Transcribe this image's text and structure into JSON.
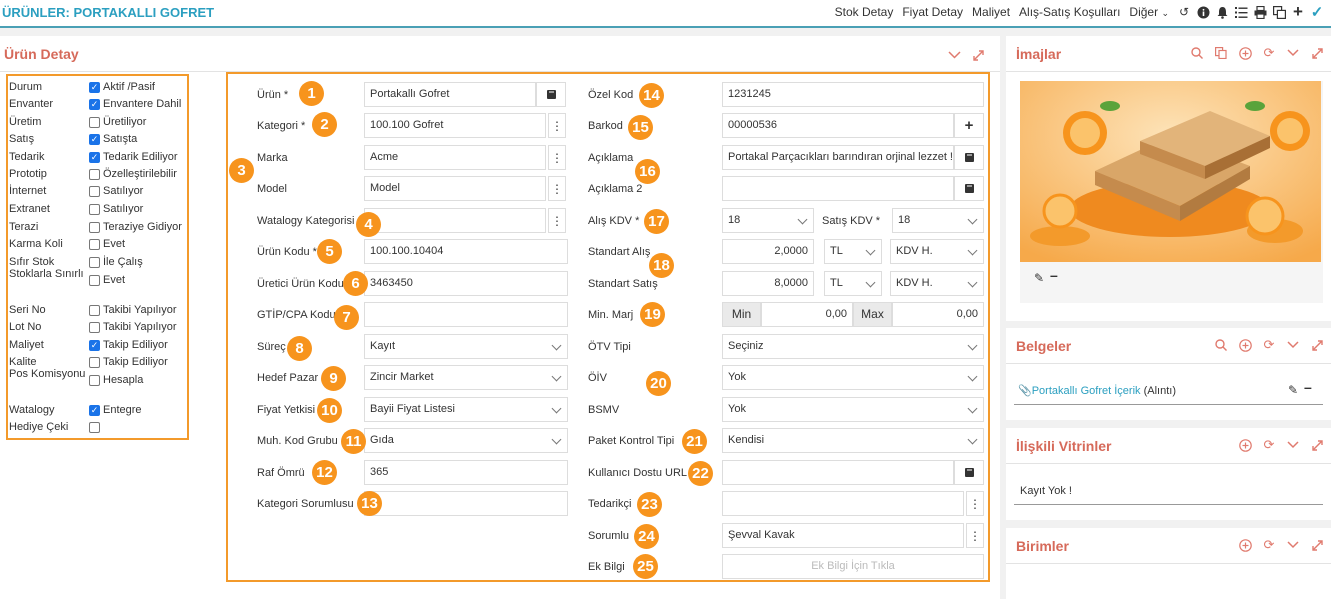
{
  "header": {
    "title": "ÜRÜNLER: PORTAKALLI GOFRET",
    "nav": [
      "Stok Detay",
      "Fiyat Detay",
      "Maliyet",
      "Alış-Satış Koşulları",
      "Diğer"
    ],
    "icons": [
      "history-icon",
      "info-icon",
      "bell-icon",
      "list-icon",
      "print-icon",
      "copy-icon",
      "plus-icon"
    ]
  },
  "main": {
    "title": "Ürün Detay"
  },
  "status": [
    {
      "label": "Durum",
      "checked": true,
      "value": "Aktif /Pasif"
    },
    {
      "label": "Envanter",
      "checked": true,
      "value": "Envantere Dahil"
    },
    {
      "label": "Üretim",
      "checked": false,
      "value": "Üretiliyor"
    },
    {
      "label": "Satış",
      "checked": true,
      "value": "Satışta"
    },
    {
      "label": "Tedarik",
      "checked": true,
      "value": "Tedarik Ediliyor"
    },
    {
      "label": "Prototip",
      "checked": false,
      "value": "Özelleştirilebilir"
    },
    {
      "label": "İnternet",
      "checked": false,
      "value": "Satılıyor"
    },
    {
      "label": "Extranet",
      "checked": false,
      "value": "Satılıyor"
    },
    {
      "label": "Terazi",
      "checked": false,
      "value": "Teraziye Gidiyor"
    },
    {
      "label": "Karma Koli",
      "checked": false,
      "value": "Evet"
    },
    {
      "label": "Sıfır Stok",
      "checked": false,
      "value": "İle Çalış"
    },
    {
      "label": "Stoklarla Sınırlı",
      "checked": false,
      "value": "Evet"
    },
    {
      "label": "Seri No",
      "checked": false,
      "value": "Takibi Yapılıyor"
    },
    {
      "label": "Lot No",
      "checked": false,
      "value": "Takibi Yapılıyor"
    },
    {
      "label": "Maliyet",
      "checked": true,
      "value": "Takip Ediliyor"
    },
    {
      "label": "Kalite",
      "checked": false,
      "value": "Takip Ediliyor"
    },
    {
      "label": "Pos Komisyonu",
      "checked": false,
      "value": "Hesapla"
    },
    {
      "label": "Watalogy",
      "checked": true,
      "value": "Entegre"
    },
    {
      "label": "Hediye Çeki",
      "checked": false,
      "value": ""
    }
  ],
  "left": {
    "urun_label": "Ürün *",
    "urun": "Portakallı Gofret",
    "kategori_label": "Kategori *",
    "kategori": "100.100 Gofret",
    "marka_label": "Marka",
    "marka": "Acme",
    "model_label": "Model",
    "model": "Model",
    "watalogy_label": "Watalogy Kategorisi",
    "watalogy": "",
    "urunkodu_label": "Ürün Kodu *",
    "urunkodu": "100.100.10404",
    "uretici_label": "Üretici Ürün Kodu",
    "uretici": "3463450",
    "gtip_label": "GTİP/CPA Kodu",
    "gtip": "",
    "surec_label": "Süreç",
    "surec": "Kayıt",
    "hedef_label": "Hedef Pazar",
    "hedef": "Zincir Market",
    "fiyat_label": "Fiyat Yetkisi",
    "fiyat": "Bayii Fiyat Listesi",
    "muh_label": "Muh. Kod Grubu",
    "muh": "Gıda",
    "raf_label": "Raf Ömrü",
    "raf": "365",
    "katsor_label": "Kategori Sorumlusu",
    "katsor": ""
  },
  "right": {
    "ozel_label": "Özel Kod",
    "ozel": "1231245",
    "barkod_label": "Barkod",
    "barkod": "00000536",
    "aciklama_label": "Açıklama",
    "aciklama": "Portakal Parçacıkları barındıran orjinal lezzet !",
    "aciklama2_label": "Açıklama 2",
    "aciklama2": "",
    "aliskdv_label": "Alış KDV *",
    "aliskdv": "18",
    "satiskdv_label": "Satış KDV *",
    "satiskdv": "18",
    "stdalis_label": "Standart Alış",
    "stdalis": "2,0000",
    "stdalis_cur": "TL",
    "stdalis_kdv": "KDV H.",
    "stdsatis_label": "Standart Satış",
    "stdsatis": "8,0000",
    "stdsatis_cur": "TL",
    "stdsatis_kdv": "KDV H.",
    "minmarj_label": "Min. Marj",
    "min_label": "Min",
    "min": "0,00",
    "max_label": "Max",
    "max": "0,00",
    "otv_label": "ÖTV Tipi",
    "otv": "Seçiniz",
    "oiv_label": "ÖİV",
    "oiv": "Yok",
    "bsmv_label": "BSMV",
    "bsmv": "Yok",
    "paket_label": "Paket Kontrol Tipi",
    "paket": "Kendisi",
    "url_label": "Kullanıcı Dostu URL",
    "url": "",
    "tedarikci_label": "Tedarikçi",
    "tedarikci": "",
    "sorumlu_label": "Sorumlu",
    "sorumlu": "Şevval Kavak",
    "ekbilgi_label": "Ek Bilgi",
    "ekbilgi_placeholder": "Ek Bilgi İçin Tıkla"
  },
  "badges": [
    "1",
    "2",
    "3",
    "4",
    "5",
    "6",
    "7",
    "8",
    "9",
    "10",
    "11",
    "12",
    "13",
    "14",
    "15",
    "16",
    "17",
    "18",
    "19",
    "20",
    "21",
    "22",
    "23",
    "24",
    "25"
  ],
  "side": {
    "imajlar": "İmajlar",
    "belgeler": "Belgeler",
    "belge_link": "Portakallı Gofret İçerik",
    "belge_note": "(Alıntı)",
    "vitrinler": "İlişkili Vitrinler",
    "vitrin_empty": "Kayıt Yok !",
    "birimler": "Birimler"
  },
  "colors": {
    "accent": "#2b9fc0",
    "title": "#d66a5a",
    "highlight": "#f39a2b",
    "badge": "#f7941d",
    "check": "#1a73e8"
  }
}
